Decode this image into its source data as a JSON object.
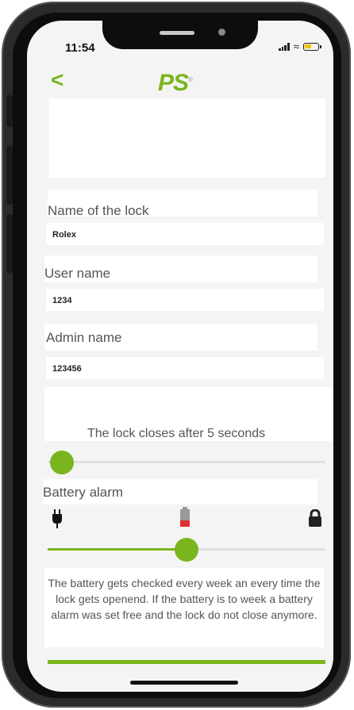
{
  "status_bar": {
    "time": "11:54"
  },
  "header": {
    "back_label": "<",
    "logo_text": "PS",
    "logo_mark": "®"
  },
  "lock_name": {
    "label": "Name of the lock",
    "value": "Rolex"
  },
  "user_name": {
    "label": "User name",
    "value": "1234"
  },
  "admin_name": {
    "label": "Admin name",
    "value": "123456"
  },
  "close_timer": {
    "text": "The lock closes after 5 seconds",
    "level": 0.05
  },
  "battery_alarm": {
    "label": "Battery alarm",
    "level": 0.5,
    "icons": [
      "plug-icon",
      "battery-low-icon",
      "lock-icon"
    ],
    "info": "The battery gets checked every week an every time the lock gets openend. If the battery is to week a battery alarm was set free and the lock do not close anymore."
  },
  "colors": {
    "accent": "#7ab51d",
    "warning": "#e03030"
  }
}
